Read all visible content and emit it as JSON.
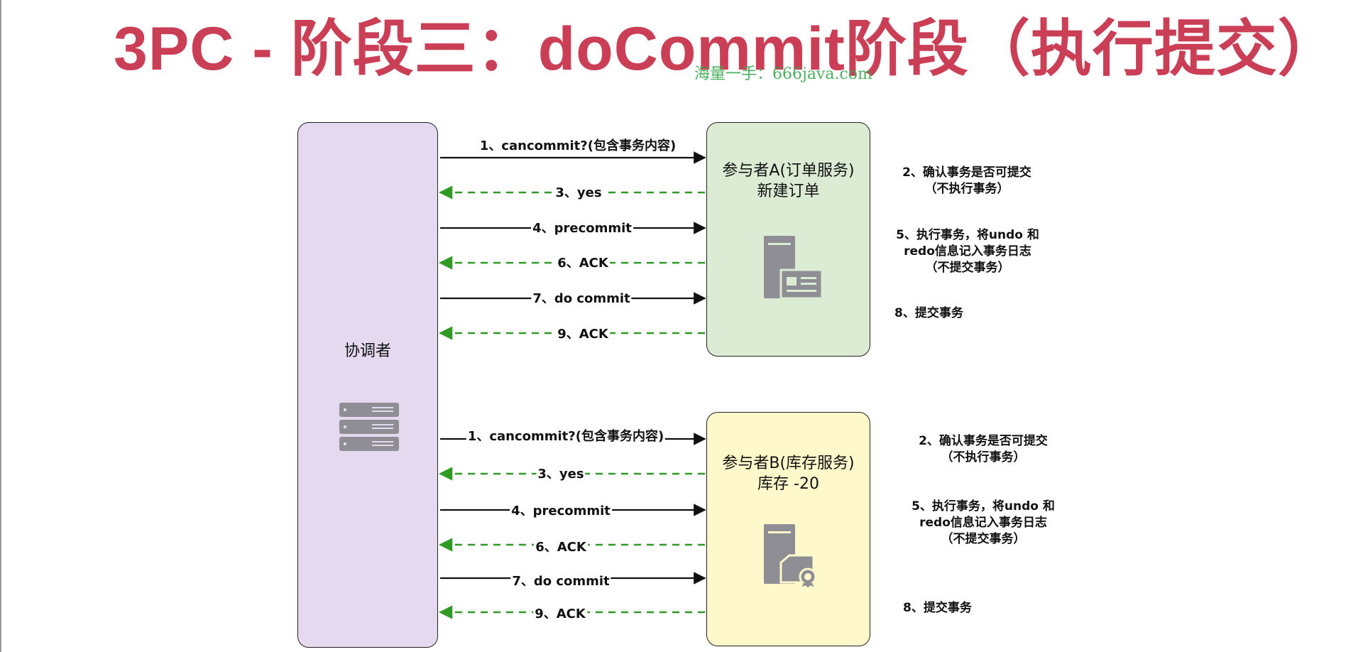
{
  "title": "3PC - 阶段三：doCommit阶段（执行提交）",
  "watermark": "海量一手：666java.com",
  "colors": {
    "title": "#cb3f56",
    "coordinator": "#e4d9ee",
    "participant_a": "#dcebd4",
    "participant_b": "#fef8cb",
    "solid_arrow": "#111111",
    "dashed_arrow": "#2f9a24"
  },
  "coordinator": {
    "label": "协调者",
    "icon": "server-rack-icon"
  },
  "participant_a": {
    "label_line1": "参与者A(订单服务)",
    "label_line2": "新建订单",
    "icon": "server-document-icon",
    "messages": [
      "1、cancommit?(包含事务内容)",
      "3、yes",
      "4、precommit",
      "6、ACK",
      "7、do commit",
      "9、ACK"
    ],
    "notes": {
      "step2": [
        "2、确认事务是否可提交",
        "（不执行事务）"
      ],
      "step5": [
        "5、执行事务，将undo 和",
        "redo信息记入事务日志",
        "（不提交事务）"
      ],
      "step8": [
        "8、提交事务"
      ]
    }
  },
  "participant_b": {
    "label_line1": "参与者B(库存服务)",
    "label_line2": "库存 -20",
    "icon": "server-certificate-icon",
    "messages": [
      "1、cancommit?(包含事务内容)",
      "3、yes",
      "4、precommit",
      "6、ACK",
      "7、do commit",
      "9、ACK"
    ],
    "notes": {
      "step2": [
        "2、确认事务是否可提交",
        "（不执行事务）"
      ],
      "step5": [
        "5、执行事务，将undo 和",
        "redo信息记入事务日志",
        "（不提交事务）"
      ],
      "step8": [
        "8、提交事务"
      ]
    }
  }
}
